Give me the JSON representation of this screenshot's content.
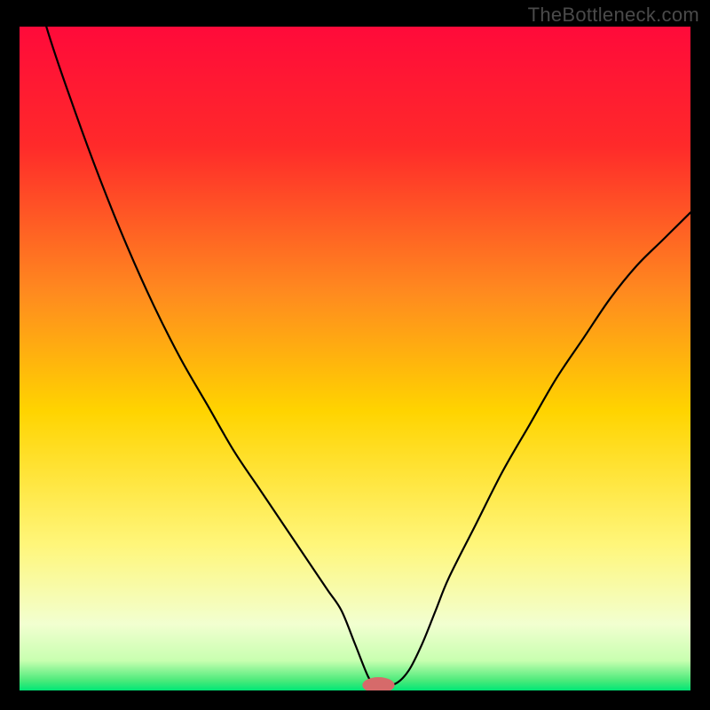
{
  "watermark": "TheBottleneck.com",
  "colors": {
    "background": "#000000",
    "watermark_text": "#4a4a4a",
    "curve": "#000000",
    "marker_fill": "#d66a6a",
    "gradient_top": "#ff0a3a",
    "gradient_mid": "#ffd400",
    "gradient_bottom_light": "#f9ffe0",
    "gradient_green": "#00e676"
  },
  "chart_data": {
    "type": "line",
    "title": "",
    "xlabel": "",
    "ylabel": "",
    "xlim": [
      0,
      100
    ],
    "ylim": [
      0,
      100
    ],
    "grid": false,
    "legend": null,
    "series": [
      {
        "name": "bottleneck-curve",
        "x": [
          0,
          4,
          8,
          12,
          16,
          20,
          24,
          28,
          32,
          36,
          40,
          44,
          46,
          48,
          50,
          52,
          53,
          54,
          56,
          58,
          60,
          62,
          64,
          68,
          72,
          76,
          80,
          84,
          88,
          92,
          96,
          100
        ],
        "y": [
          115,
          100,
          88,
          77,
          67,
          58,
          50,
          43,
          36,
          30,
          24,
          18,
          15,
          12,
          7,
          2,
          1,
          1,
          1,
          3,
          7,
          12,
          17,
          25,
          33,
          40,
          47,
          53,
          59,
          64,
          68,
          72
        ]
      }
    ],
    "marker": {
      "x": 53.5,
      "y": 0.8,
      "rx": 2.4,
      "ry": 1.2
    },
    "gradient_stops": [
      {
        "offset": 0.0,
        "color": "#ff0a3a"
      },
      {
        "offset": 0.18,
        "color": "#ff2a2a"
      },
      {
        "offset": 0.4,
        "color": "#ff8a1f"
      },
      {
        "offset": 0.58,
        "color": "#ffd400"
      },
      {
        "offset": 0.78,
        "color": "#fff67a"
      },
      {
        "offset": 0.9,
        "color": "#f2ffd0"
      },
      {
        "offset": 0.955,
        "color": "#c8ffb0"
      },
      {
        "offset": 0.985,
        "color": "#4bea7a"
      },
      {
        "offset": 1.0,
        "color": "#00e676"
      }
    ]
  }
}
